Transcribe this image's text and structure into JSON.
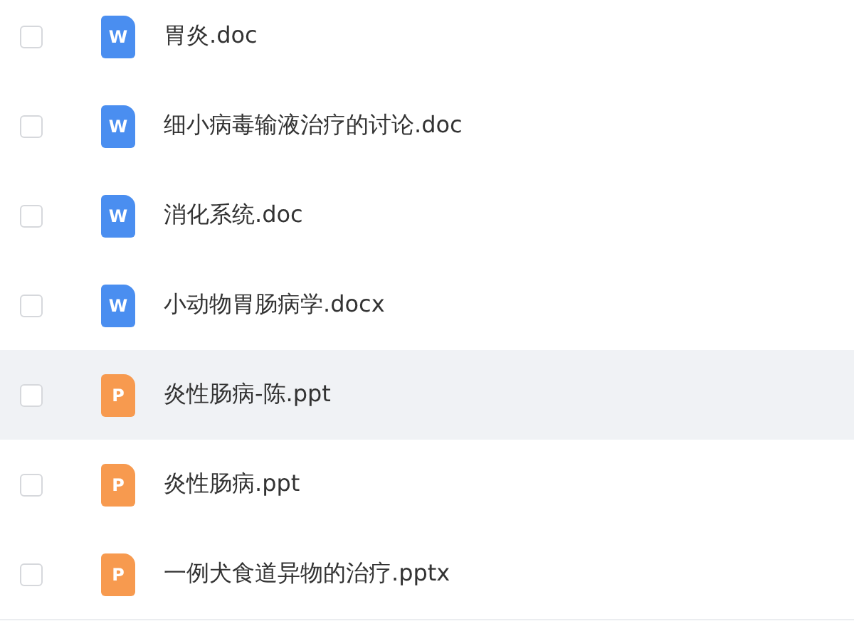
{
  "files": [
    {
      "name": "胃炎.doc",
      "kind": "word",
      "icon_letter": "W",
      "checked": false,
      "highlighted": false
    },
    {
      "name": "细小病毒输液治疗的讨论.doc",
      "kind": "word",
      "icon_letter": "W",
      "checked": false,
      "highlighted": false
    },
    {
      "name": "消化系统.doc",
      "kind": "word",
      "icon_letter": "W",
      "checked": false,
      "highlighted": false
    },
    {
      "name": "小动物胃肠病学.docx",
      "kind": "word",
      "icon_letter": "W",
      "checked": false,
      "highlighted": false
    },
    {
      "name": "炎性肠病-陈.ppt",
      "kind": "slides",
      "icon_letter": "P",
      "checked": false,
      "highlighted": true
    },
    {
      "name": "炎性肠病.ppt",
      "kind": "slides",
      "icon_letter": "P",
      "checked": false,
      "highlighted": false
    },
    {
      "name": "一例犬食道异物的治疗.pptx",
      "kind": "slides",
      "icon_letter": "P",
      "checked": false,
      "highlighted": false
    }
  ]
}
